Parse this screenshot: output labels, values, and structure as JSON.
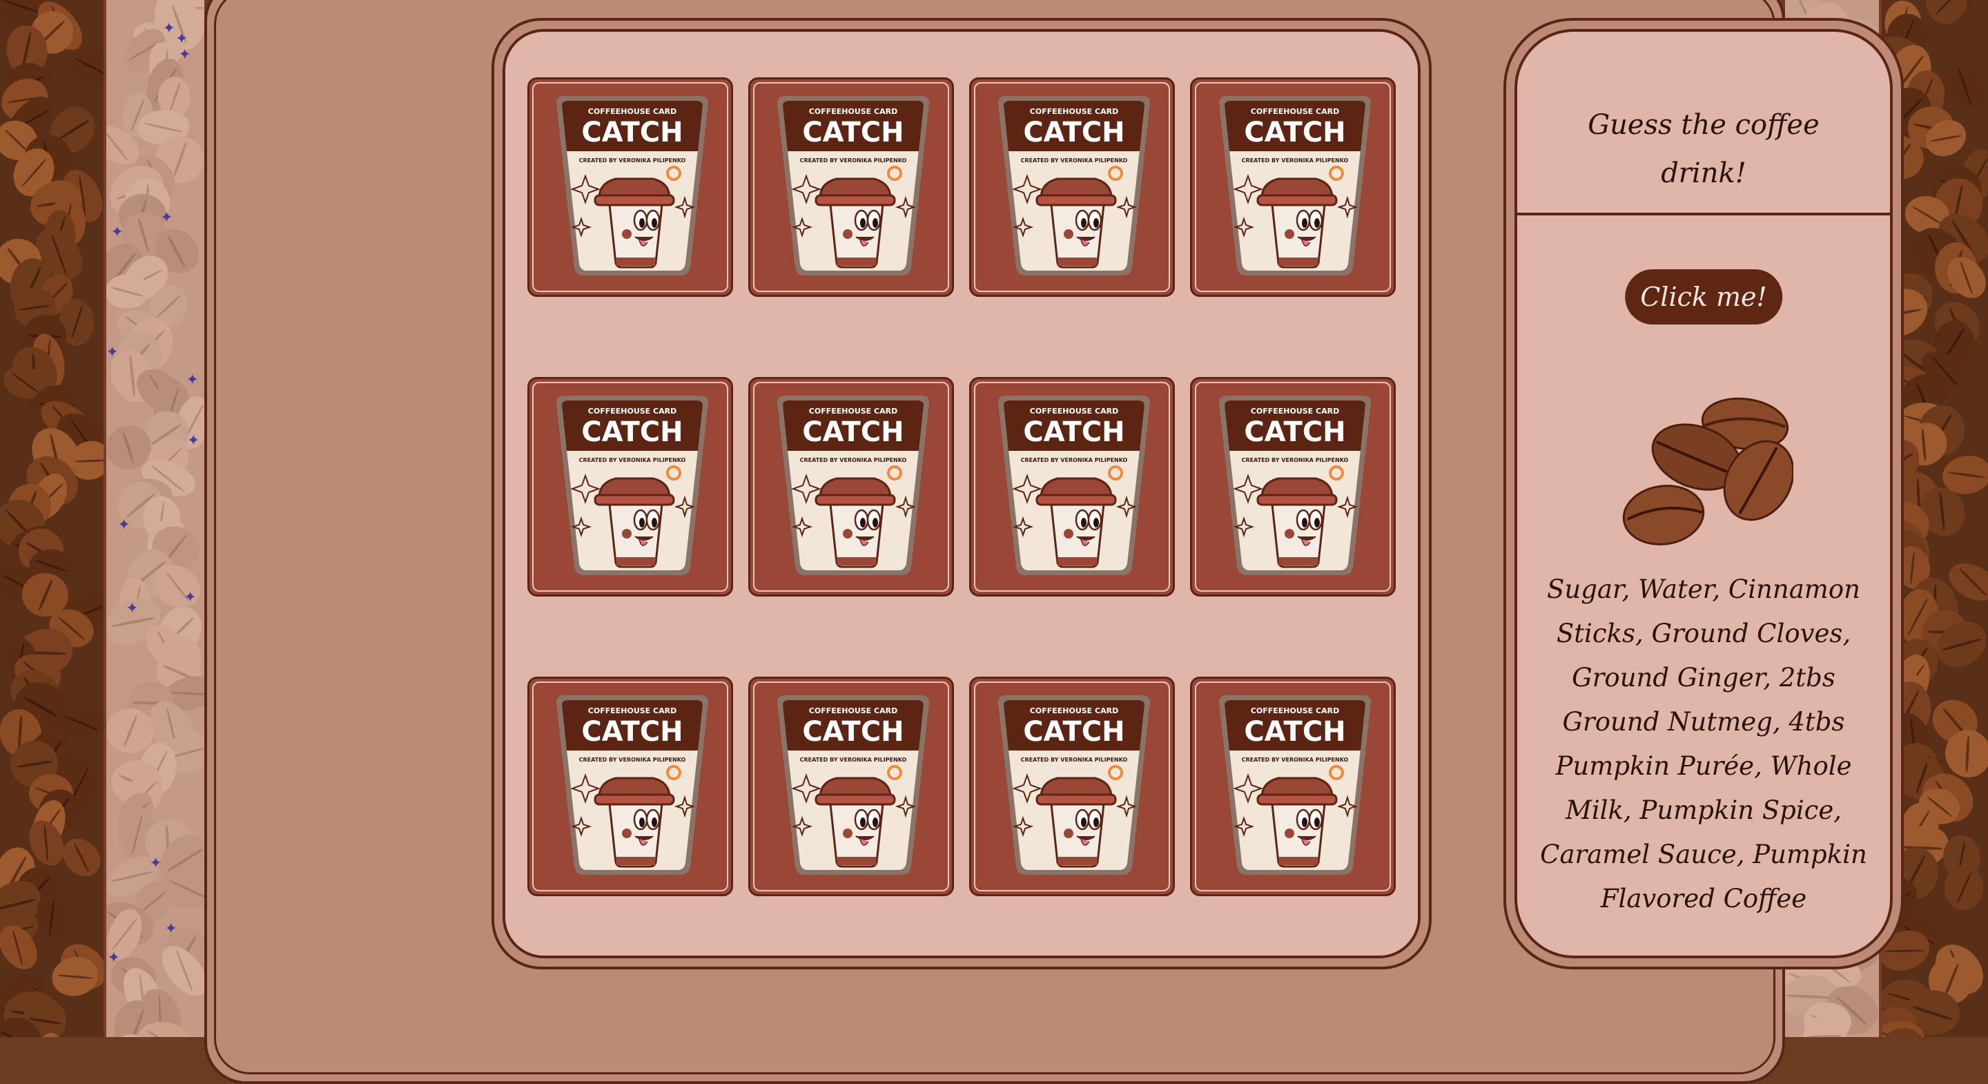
{
  "game": {
    "card_count": 12,
    "card_back": {
      "top_line": "COFFEEHOUSE CARD",
      "title": "CATCH",
      "credit": "CREATED BY VERONIKA PILIPENKO",
      "icon": "coffee-cup-mascot-icon"
    }
  },
  "side_panel": {
    "title": "Guess the coffee drink!",
    "button_label": "Click me!",
    "illustration": "coffee-beans-icon",
    "ingredients": "Sugar, Water, Cinnamon Sticks, Ground Cloves, Ground Ginger, 2tbs Ground Nutmeg, 4tbs Pumpkin Purée, Whole Milk, Pumpkin Spice, Caramel Sauce, Pumpkin Flavored Coffee"
  },
  "colors": {
    "background": "#bc8a76",
    "panel": "#e0b6aa",
    "border": "#5a2516",
    "card": "#9b4737",
    "button": "#5e2613"
  }
}
